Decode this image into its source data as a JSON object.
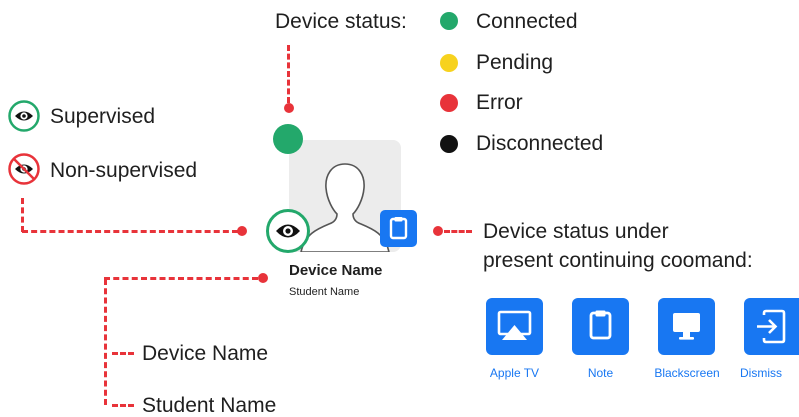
{
  "status_legend": {
    "heading": "Device status:",
    "items": [
      {
        "label": "Connected",
        "color": "#23a86b"
      },
      {
        "label": "Pending",
        "color": "#f7d21e"
      },
      {
        "label": "Error",
        "color": "#e8333a"
      },
      {
        "label": "Disconnected",
        "color": "#111111"
      }
    ]
  },
  "supervision_legend": {
    "supervised": {
      "label": "Supervised",
      "icon": "eye-icon",
      "color": "#23a86b"
    },
    "non_supervised": {
      "label": "Non-supervised",
      "icon": "eye-slash-icon",
      "color": "#e8333a"
    }
  },
  "device_card": {
    "device_name": "Device Name",
    "student_name": "Student Name",
    "status_color": "#23a86b",
    "supervision_icon": "eye-icon",
    "command_icon": "clipboard-icon"
  },
  "callouts": {
    "device_name": "Device Name",
    "student_name": "Student Name",
    "command_line1": "Device status under",
    "command_line2": "present continuing coomand:"
  },
  "commands": [
    {
      "label": "Apple TV",
      "icon": "airplay-icon"
    },
    {
      "label": "Note",
      "icon": "clipboard-icon"
    },
    {
      "label": "Blackscreen",
      "icon": "monitor-icon"
    },
    {
      "label": "Dismiss",
      "icon": "exit-icon"
    }
  ],
  "accent_color": "#1877f2"
}
